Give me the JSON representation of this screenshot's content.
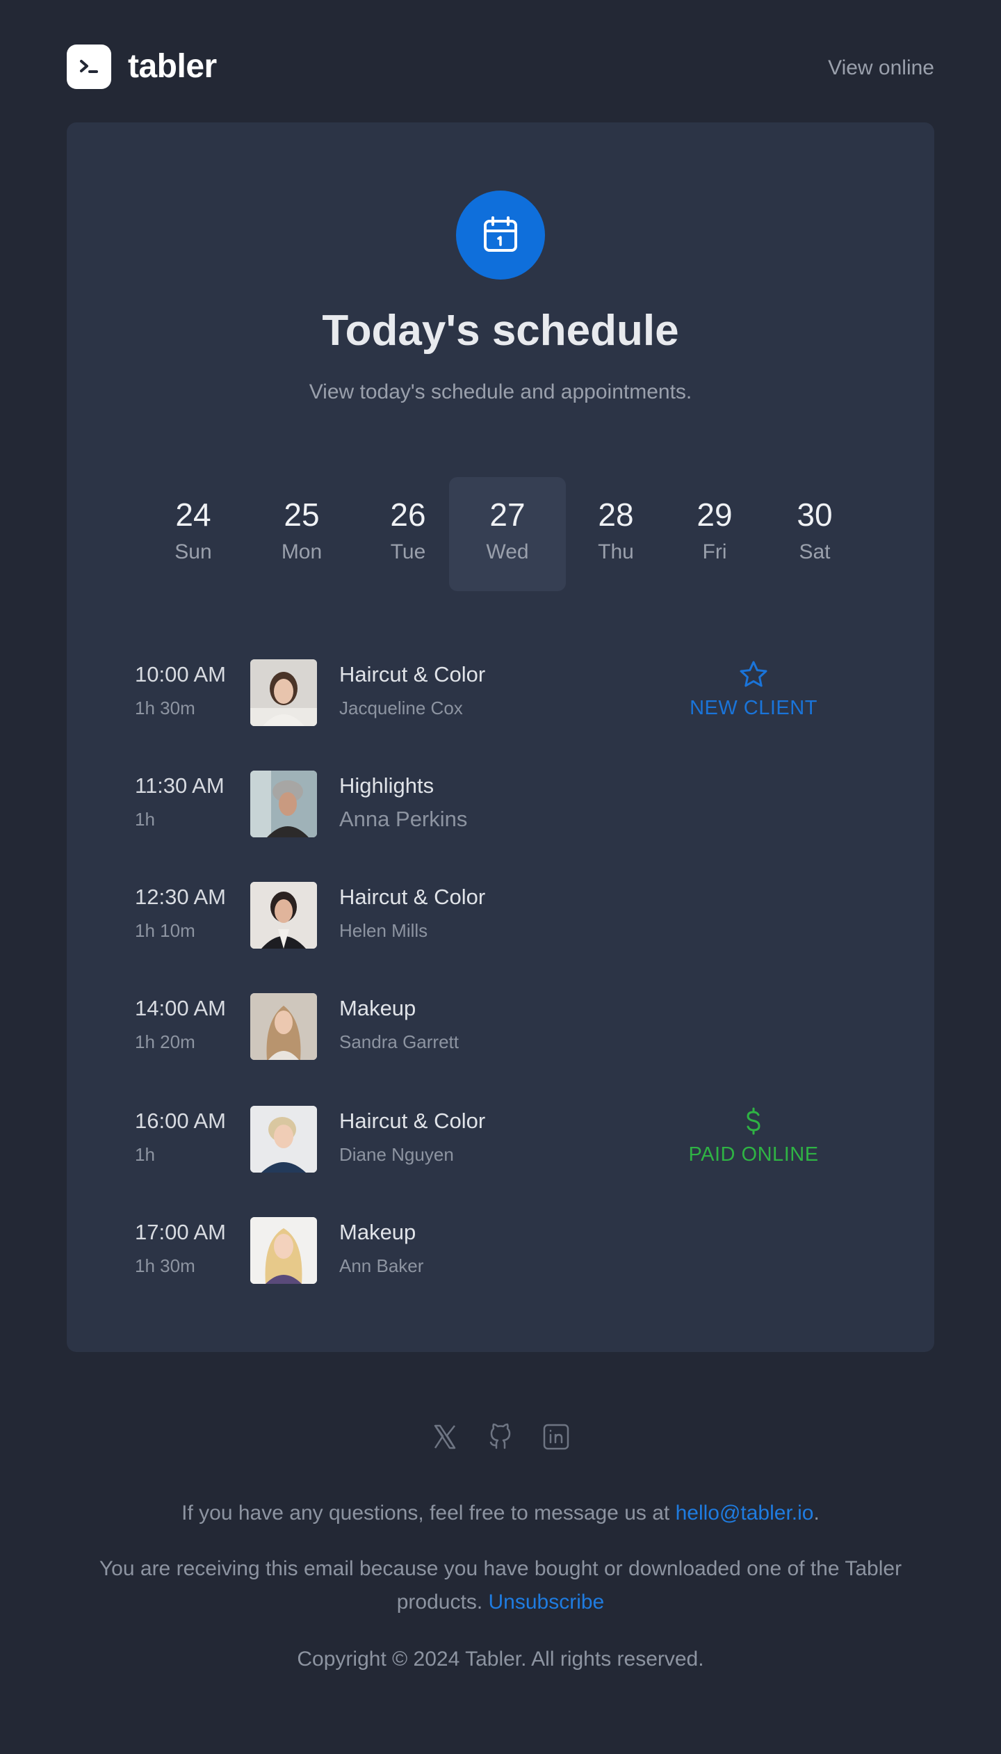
{
  "header": {
    "brand": "tabler",
    "view_online": "View online"
  },
  "hero": {
    "icon": "calendar-icon",
    "title": "Today's schedule",
    "subtitle": "View today's schedule and appointments."
  },
  "days": [
    {
      "num": "24",
      "dow": "Sun"
    },
    {
      "num": "25",
      "dow": "Mon"
    },
    {
      "num": "26",
      "dow": "Tue"
    },
    {
      "num": "27",
      "dow": "Wed",
      "active": true
    },
    {
      "num": "28",
      "dow": "Thu"
    },
    {
      "num": "29",
      "dow": "Fri"
    },
    {
      "num": "30",
      "dow": "Sat"
    }
  ],
  "appointments": [
    {
      "time": "10:00 AM",
      "duration": "1h 30m",
      "service": "Haircut & Color",
      "client": "Jacqueline Cox",
      "tag": "NEW CLIENT",
      "tag_icon": "star-icon"
    },
    {
      "time": "11:30 AM",
      "duration": "1h",
      "service": "Highlights",
      "client": "Anna Perkins"
    },
    {
      "time": "12:30 AM",
      "duration": "1h 10m",
      "service": "Haircut & Color",
      "client": "Helen Mills"
    },
    {
      "time": "14:00 AM",
      "duration": "1h 20m",
      "service": "Makeup",
      "client": "Sandra Garrett"
    },
    {
      "time": "16:00 AM",
      "duration": "1h",
      "service": "Haircut & Color",
      "client": "Diane Nguyen",
      "tag": "PAID ONLINE",
      "tag_icon": "dollar-icon"
    },
    {
      "time": "17:00 AM",
      "duration": "1h 30m",
      "service": "Makeup",
      "client": "Ann Baker"
    }
  ],
  "footer": {
    "social_icons": [
      "x-icon",
      "github-icon",
      "linkedin-icon"
    ],
    "questions_prefix": "If you have any questions, feel free to message us at ",
    "email": "hello@tabler.io",
    "questions_suffix": ".",
    "receiving_line1": "You are receiving this email because you have bought or downloaded one of the Tabler",
    "receiving_line2": "products.",
    "unsubscribe": "Unsubscribe",
    "copyright": "Copyright © 2024 Tabler. All rights reserved."
  },
  "colors": {
    "background": "#232835",
    "card": "#2c3446",
    "accent_blue": "#0f6fdb",
    "green": "#2fb344"
  }
}
